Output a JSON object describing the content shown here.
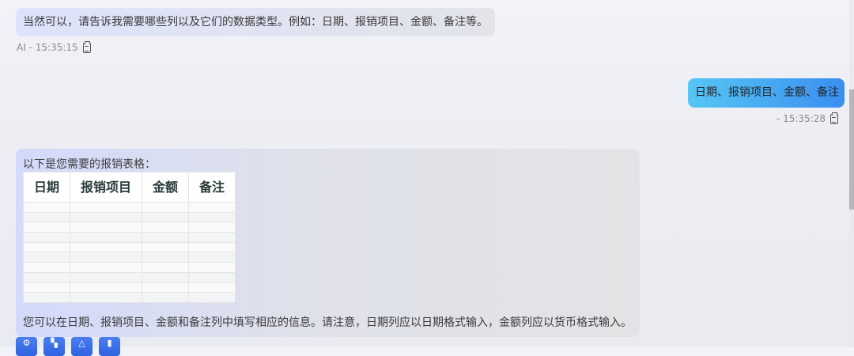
{
  "messages": {
    "ai_1": {
      "text": "当然可以，请告诉我需要哪些列以及它们的数据类型。例如：日期、报销项目、金额、备注等。",
      "meta": "AI - 15:35:15"
    },
    "user_1": {
      "text": "日期、报销项目、金额、备注",
      "meta": "- 15:35:28"
    },
    "ai_2": {
      "intro": "以下是您需要的报销表格：",
      "table": {
        "headers": [
          "日期",
          "报销项目",
          "金额",
          "备注"
        ]
      },
      "outro": "您可以在日期、报销项目、金额和备注列中填写相应的信息。请注意，日期列应以日期格式输入，金额列应以货币格式输入。"
    }
  },
  "actions": [
    "settings-icon",
    "copy-icon",
    "edit-icon",
    "delete-icon"
  ],
  "colors": {
    "user_bubble_start": "#56c6f4",
    "user_bubble_end": "#3a8ef0",
    "action_button": "#2f63e0"
  }
}
